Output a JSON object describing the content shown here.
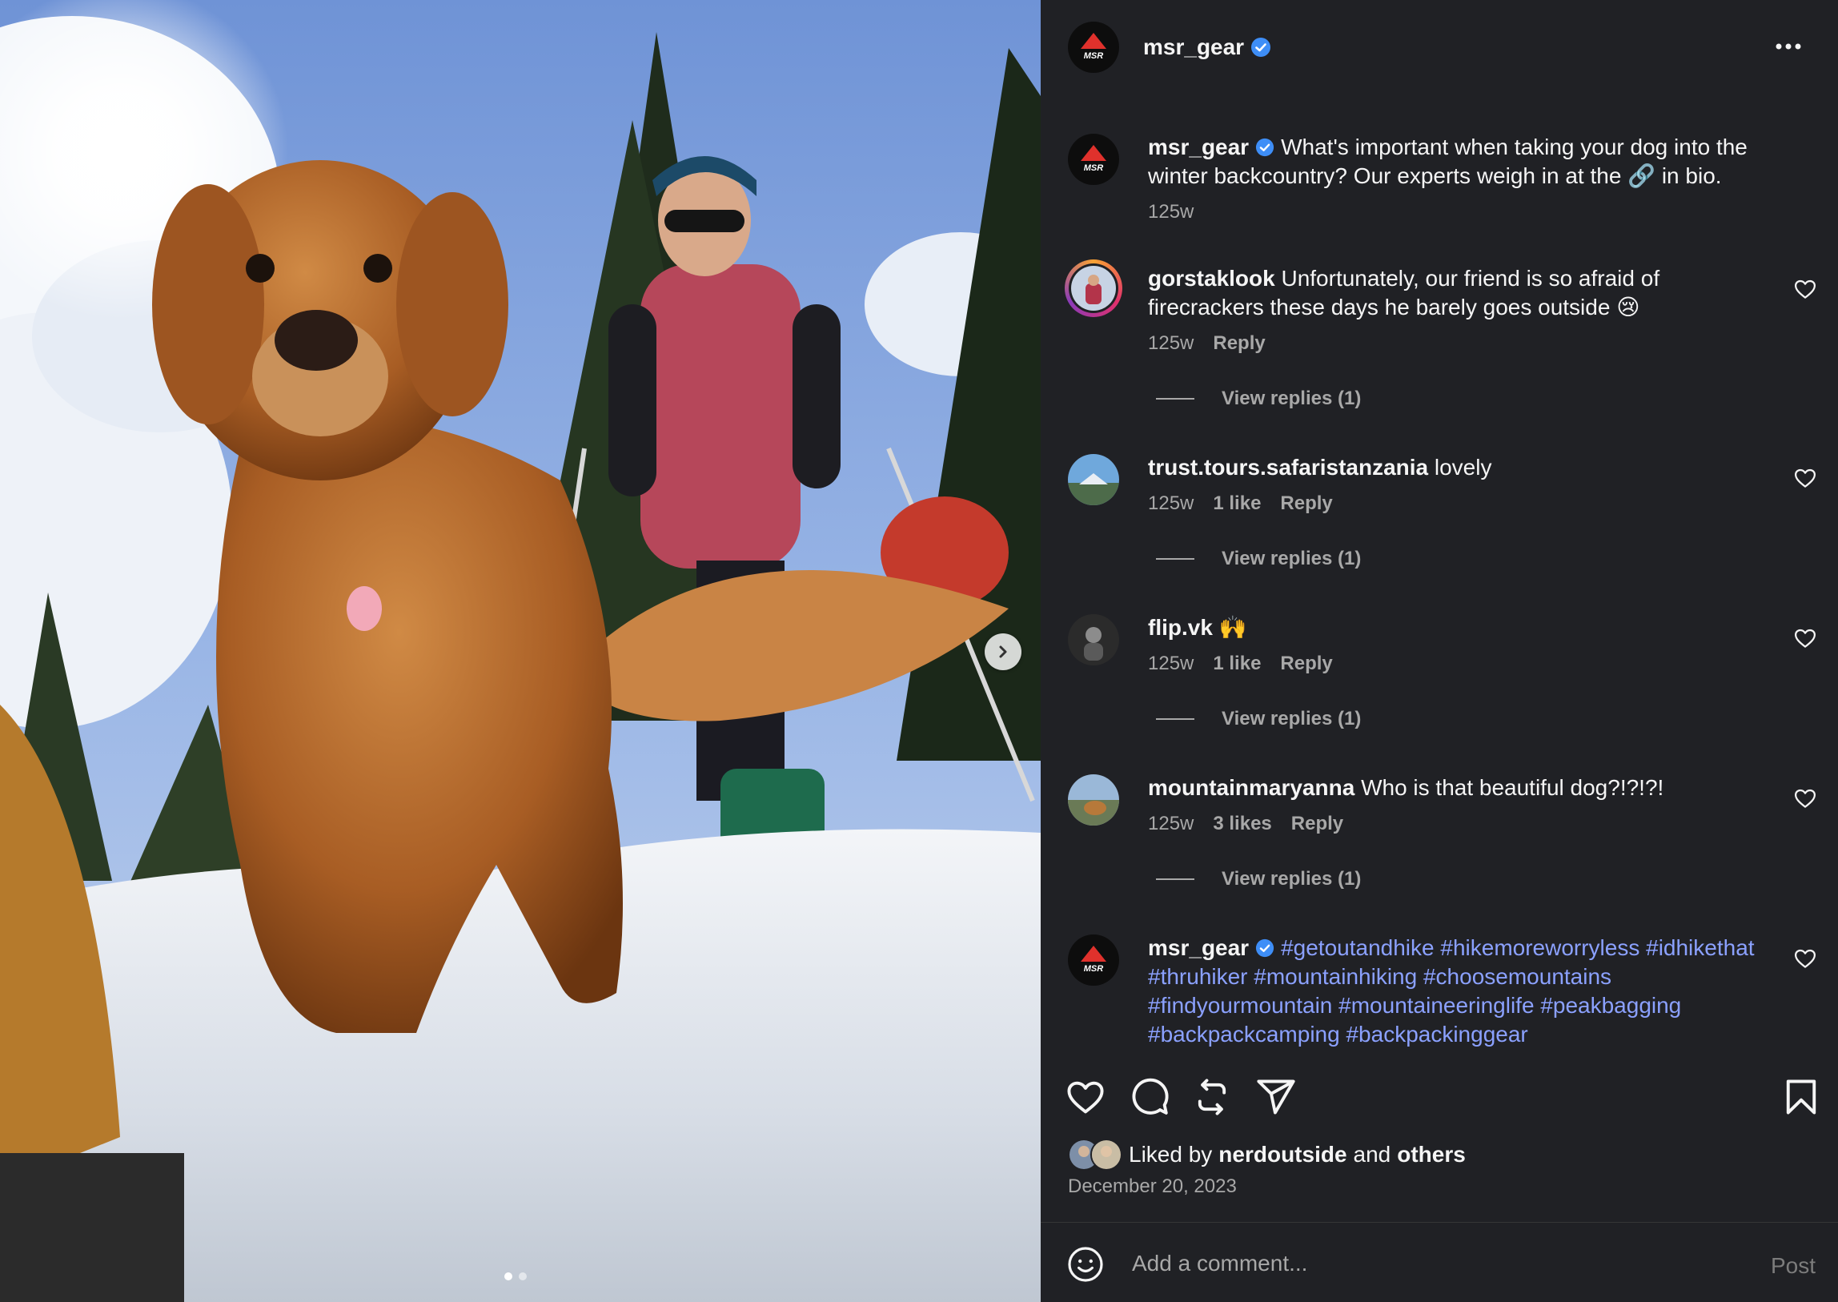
{
  "post": {
    "author": "msr_gear",
    "avatar_text": "MSR",
    "photo_count": 2,
    "active_photo": 1
  },
  "caption": {
    "user": "msr_gear",
    "text": "What's important when taking your dog into the winter backcountry? Our experts weigh in at the 🔗 in bio.",
    "time": "125w"
  },
  "comments": [
    {
      "user": "gorstaklook",
      "text": "Unfortunately, our friend is so afraid of firecrackers these days he barely goes outside 😢",
      "time": "125w",
      "likes": "",
      "reply_label": "Reply",
      "view_replies": "View replies (1)"
    },
    {
      "user": "trust.tours.safaristanzania",
      "text": "lovely",
      "time": "125w",
      "likes": "1 like",
      "reply_label": "Reply",
      "view_replies": "View replies (1)"
    },
    {
      "user": "flip.vk",
      "text": "🙌",
      "time": "125w",
      "likes": "1 like",
      "reply_label": "Reply",
      "view_replies": "View replies (1)"
    },
    {
      "user": "mountainmaryanna",
      "text": "Who is that beautiful dog?!?!?!",
      "time": "125w",
      "likes": "3 likes",
      "reply_label": "Reply",
      "view_replies": "View replies (1)"
    }
  ],
  "hashtag_comment": {
    "user": "msr_gear",
    "text": "#getoutandhike #hikemoreworryless #idhikethat #thruhiker #mountainhiking #choosemountains #findyourmountain #mountaineeringlife #peakbagging #backpackcamping #backpackinggear"
  },
  "liked_by": {
    "prefix": "Liked by",
    "user": "nerdoutside",
    "joiner": "and",
    "others": "others"
  },
  "date": "December 20, 2023",
  "add_comment": {
    "placeholder": "Add a comment...",
    "post_label": "Post"
  },
  "colors": {
    "panel_bg": "#202125",
    "text": "#f5f5f5",
    "muted": "#a8a8a8",
    "hashtag": "#8ba1ff",
    "verified": "#3e8ef7",
    "msr_red": "#e0312c"
  }
}
